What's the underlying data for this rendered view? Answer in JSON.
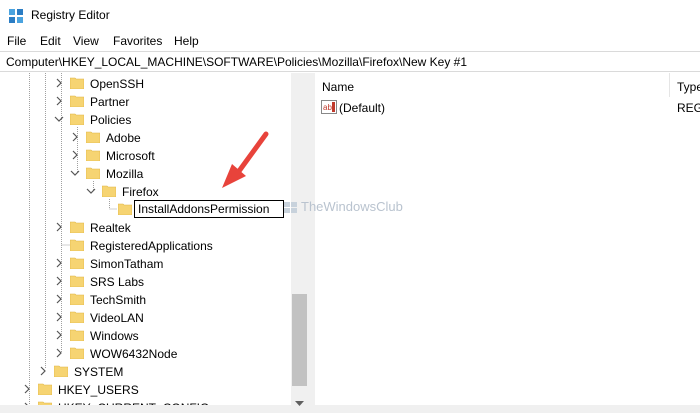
{
  "window": {
    "title": "Registry Editor"
  },
  "menu": [
    "File",
    "Edit",
    "View",
    "Favorites",
    "Help"
  ],
  "address": "Computer\\HKEY_LOCAL_MACHINE\\SOFTWARE\\Policies\\Mozilla\\Firefox\\New Key #1",
  "tree": {
    "items": [
      {
        "label": "OpenSSH",
        "level": 3,
        "expander": "right"
      },
      {
        "label": "Partner",
        "level": 3,
        "expander": "right"
      },
      {
        "label": "Policies",
        "level": 3,
        "expander": "down"
      },
      {
        "label": "Adobe",
        "level": 4,
        "expander": "right"
      },
      {
        "label": "Microsoft",
        "level": 4,
        "expander": "right"
      },
      {
        "label": "Mozilla",
        "level": 4,
        "expander": "down"
      },
      {
        "label": "Firefox",
        "level": 5,
        "expander": "down"
      },
      {
        "label": "",
        "level": 6,
        "expander": "none"
      },
      {
        "label": "Realtek",
        "level": 3,
        "expander": "right"
      },
      {
        "label": "RegisteredApplications",
        "level": 3,
        "expander": "none"
      },
      {
        "label": "SimonTatham",
        "level": 3,
        "expander": "right"
      },
      {
        "label": "SRS Labs",
        "level": 3,
        "expander": "right"
      },
      {
        "label": "TechSmith",
        "level": 3,
        "expander": "right"
      },
      {
        "label": "VideoLAN",
        "level": 3,
        "expander": "right"
      },
      {
        "label": "Windows",
        "level": 3,
        "expander": "right"
      },
      {
        "label": "WOW6432Node",
        "level": 3,
        "expander": "right"
      },
      {
        "label": "SYSTEM",
        "level": 2,
        "expander": "right"
      },
      {
        "label": "HKEY_USERS",
        "level": 1,
        "expander": "right"
      },
      {
        "label": "HKEY_CURRENT_CONFIG",
        "level": 1,
        "expander": "right"
      }
    ],
    "rename_value": "InstallAddonsPermission"
  },
  "list": {
    "columns": [
      "Name",
      "Type"
    ],
    "rows": [
      {
        "name": "(Default)",
        "type": "REG_"
      }
    ]
  },
  "watermark": "TheWindowsClub",
  "colors": {
    "folder": "#f6d472",
    "folder_dark": "#e0b442",
    "arrow": "#e8433b",
    "selection": "#cce8ff"
  }
}
